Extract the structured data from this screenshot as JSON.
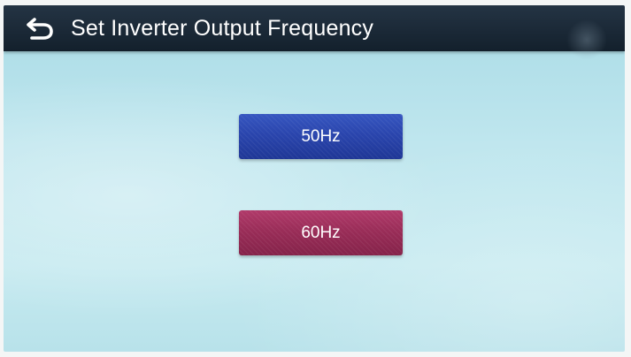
{
  "header": {
    "title": "Set Inverter Output Frequency",
    "back_icon": "back-arrow-icon",
    "background_color": "#1b2937"
  },
  "options": [
    {
      "label": "50Hz",
      "color": "#2a45ad"
    },
    {
      "label": "60Hz",
      "color": "#9a2d58"
    }
  ],
  "screen": {
    "background_color": "#bfe6ee"
  }
}
